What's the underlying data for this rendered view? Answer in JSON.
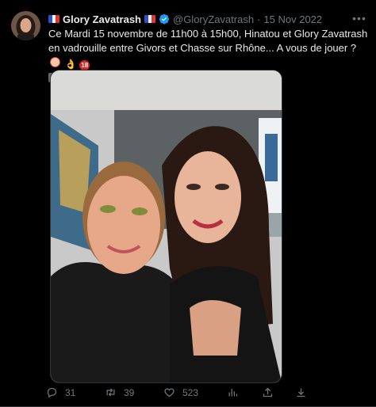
{
  "author": {
    "display_name": "Glory Zavatrash",
    "handle": "@GloryZavatrash",
    "separator": "·",
    "date": "15 Nov 2022"
  },
  "tweet_text": "Ce Mardi 15 novembre de 11h00 à 15h00, Hinatou et Glory Zavatrash en vadrouille entre Givors et Chasse sur Rhône... A vous de jouer ?",
  "emojis": [
    "clown-face-icon",
    "ok-hand-icon",
    "no-under-18-icon",
    "video-camera-icon"
  ],
  "stats": {
    "replies": "31",
    "retweets": "39",
    "likes": "523"
  },
  "colors": {
    "background": "#000000",
    "text": "#e7e9ea",
    "muted": "#71767b",
    "verified": "#1d9bf0"
  }
}
